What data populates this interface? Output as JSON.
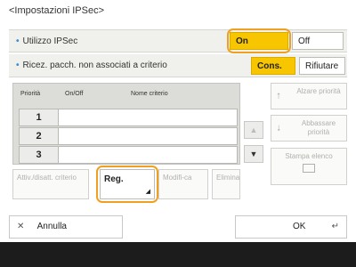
{
  "title": "<Impostazioni IPSec>",
  "ipsec": {
    "label": "Utilizzo IPSec",
    "on": "On",
    "off": "Off"
  },
  "packets": {
    "label": "Ricez. pacch. non associati a criterio",
    "accept": "Cons.",
    "refuse": "Rifiutare"
  },
  "table": {
    "headers": [
      "Priorità",
      "On/Off",
      "Nome criterio"
    ],
    "rows": [
      "1",
      "2",
      "3"
    ]
  },
  "side": {
    "raise": "Alzare priorità",
    "lower": "Abbassare priorità",
    "print": "Stampa elenco"
  },
  "actions": {
    "toggle": "Attiv./disatt. criterio",
    "register": "Reg.",
    "edit": "Modifi-ca",
    "delete": "Elimina"
  },
  "footer": {
    "cancel": "Annulla",
    "ok": "OK"
  },
  "colors": {
    "selected": "#f7c600",
    "highlight": "#f0a020",
    "bar": "#1c1c1c"
  }
}
